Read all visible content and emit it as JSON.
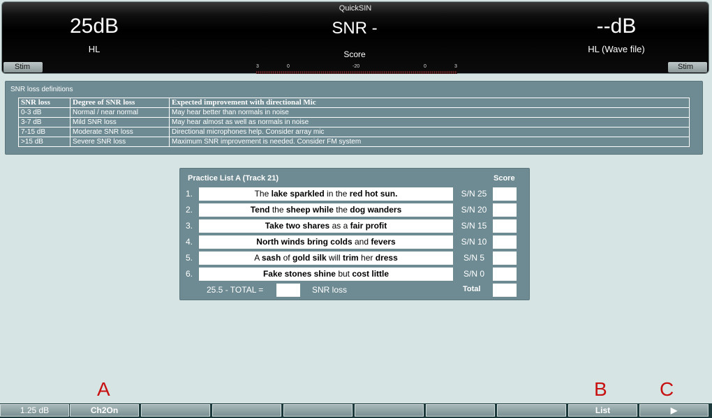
{
  "header": {
    "app_title": "QuickSIN",
    "hl_value": "25dB",
    "hl_label": "HL",
    "snr_value": "SNR -",
    "score_label": "Score",
    "wave_value": "--dB",
    "wave_label": "HL (Wave file)",
    "stim_left": "Stim",
    "stim_right": "Stim",
    "vu_scale": [
      "3",
      "0",
      "-20",
      "0",
      "3"
    ]
  },
  "definitions": {
    "title": "SNR loss definitions",
    "columns": [
      "SNR loss",
      "Degree of SNR loss",
      "Expected improvement with directional Mic"
    ],
    "rows": [
      [
        "0-3 dB",
        "Normal / near normal",
        "May hear better than normals in noise"
      ],
      [
        "3-7 dB",
        "Mild SNR loss",
        "May hear almost as well as normals in noise"
      ],
      [
        "7-15 dB",
        "Moderate SNR loss",
        "Directional microphones help. Consider array mic"
      ],
      [
        ">15 dB",
        "Severe SNR loss",
        "Maximum SNR improvement is needed. Consider FM system"
      ]
    ]
  },
  "practice": {
    "title": "Practice List A (Track 21)",
    "score_header": "Score",
    "items": [
      {
        "num": "1.",
        "sn": "S/N 25"
      },
      {
        "num": "2.",
        "sn": "S/N 20"
      },
      {
        "num": "3.",
        "sn": "S/N 15"
      },
      {
        "num": "4.",
        "sn": "S/N 10"
      },
      {
        "num": "5.",
        "sn": "S/N 5"
      },
      {
        "num": "6.",
        "sn": "S/N 0"
      }
    ],
    "s1": [
      "The",
      "lake sparkled",
      "in the",
      "red hot sun."
    ],
    "s2": [
      "Tend",
      "the",
      "sheep while",
      "the",
      "dog wanders"
    ],
    "s3": [
      "Take two shares",
      "as a",
      "fair profit"
    ],
    "s4": [
      "North winds bring colds",
      "and",
      "fevers"
    ],
    "s5": [
      "A",
      "sash",
      "of",
      "gold silk",
      "will",
      "trim",
      "her",
      "dress"
    ],
    "s6": [
      "Fake stones shine",
      "but",
      "cost little"
    ],
    "total_text": "25.5 - TOTAL =",
    "snr_loss_label": "SNR loss",
    "total_label": "Total"
  },
  "function_keys": {
    "letters": [
      "A",
      "B",
      "C"
    ],
    "labels": [
      "1.25 dB",
      "Ch2On",
      "",
      "",
      "",
      "",
      "",
      "",
      "List",
      "▶"
    ]
  }
}
